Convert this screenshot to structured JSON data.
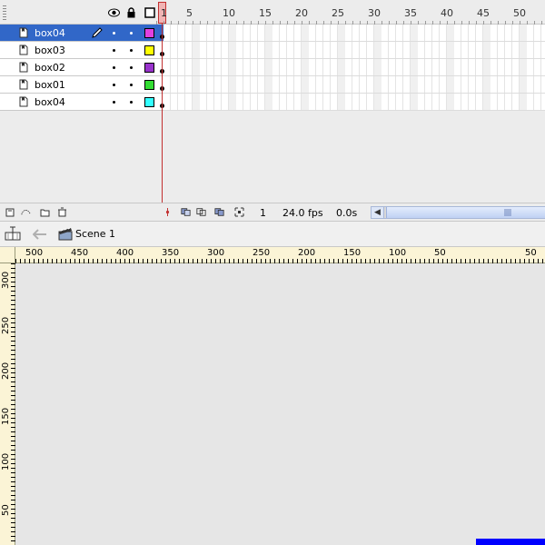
{
  "timeline": {
    "frame_numbers": [
      "5",
      "10",
      "15",
      "20",
      "25",
      "30",
      "35",
      "40",
      "45",
      "50"
    ],
    "playhead_frame": "1",
    "layers": [
      {
        "name": "box04",
        "color": "#e040e0",
        "selected": true
      },
      {
        "name": "box03",
        "color": "#ffff00",
        "selected": false
      },
      {
        "name": "box02",
        "color": "#9933cc",
        "selected": false
      },
      {
        "name": "box01",
        "color": "#33dd33",
        "selected": false
      },
      {
        "name": "box04",
        "color": "#33ffff",
        "selected": false
      }
    ],
    "status": {
      "current_frame": "1",
      "fps": "24.0 fps",
      "elapsed": "0.0s"
    },
    "icons": {
      "eye": "eye-icon",
      "lock": "lock-icon",
      "outline": "outline-icon",
      "pencil": "pencil-icon"
    }
  },
  "editbar": {
    "scene_label": "Scene 1"
  },
  "stage": {
    "hruler_labels": [
      "500",
      "450",
      "400",
      "350",
      "300",
      "250",
      "200",
      "150",
      "100",
      "50",
      "",
      "50"
    ],
    "vruler_labels": [
      "300",
      "250",
      "200",
      "150",
      "100",
      "50"
    ],
    "shape_color": "#0000ff"
  }
}
